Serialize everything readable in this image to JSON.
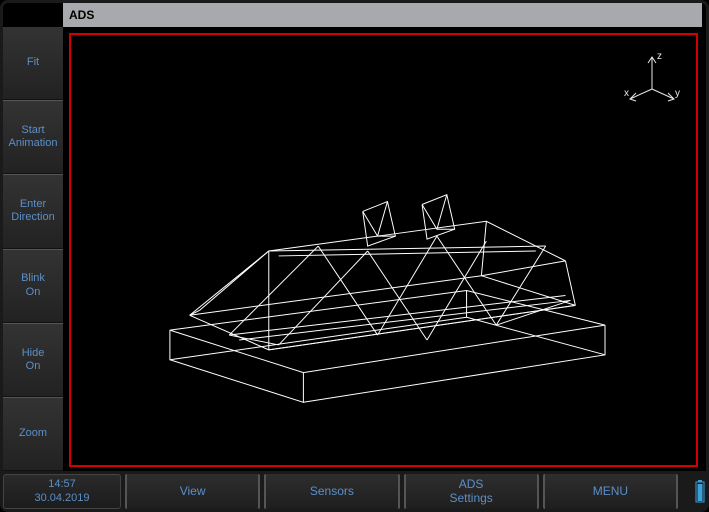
{
  "title": "ADS",
  "sidebar": {
    "items": [
      {
        "label": "Fit"
      },
      {
        "label": "Start\nAnimation"
      },
      {
        "label": "Enter\nDirection"
      },
      {
        "label": "Blink\nOn"
      },
      {
        "label": "Hide\nOn"
      },
      {
        "label": "Zoom"
      }
    ]
  },
  "axes": {
    "x": "x",
    "y": "y",
    "z": "z"
  },
  "status": {
    "time": "14:57",
    "date": "30.04.2019"
  },
  "bottom": {
    "items": [
      {
        "label": "View"
      },
      {
        "label": "Sensors"
      },
      {
        "label": "ADS\nSettings"
      },
      {
        "label": "MENU"
      }
    ]
  },
  "colors": {
    "accent": "#5b8fc9",
    "viewport_border": "#d40000",
    "wireframe": "#ffffff",
    "battery": "#3aa0d8"
  }
}
